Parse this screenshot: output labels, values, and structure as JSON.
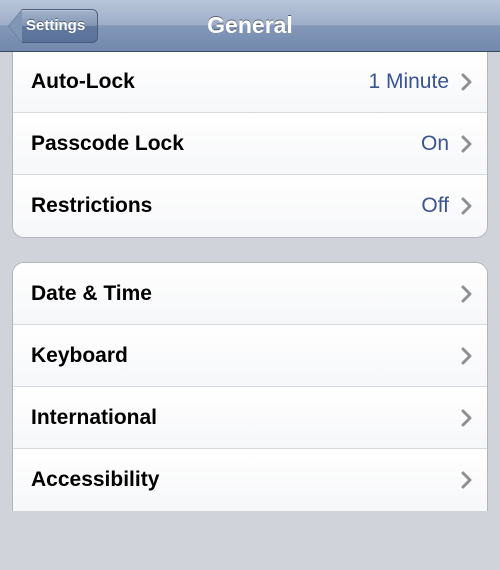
{
  "navbar": {
    "back_label": "Settings",
    "title": "General"
  },
  "group1": [
    {
      "label": "Auto-Lock",
      "value": "1 Minute"
    },
    {
      "label": "Passcode Lock",
      "value": "On"
    },
    {
      "label": "Restrictions",
      "value": "Off"
    }
  ],
  "group2": [
    {
      "label": "Date & Time"
    },
    {
      "label": "Keyboard"
    },
    {
      "label": "International"
    },
    {
      "label": "Accessibility"
    }
  ]
}
